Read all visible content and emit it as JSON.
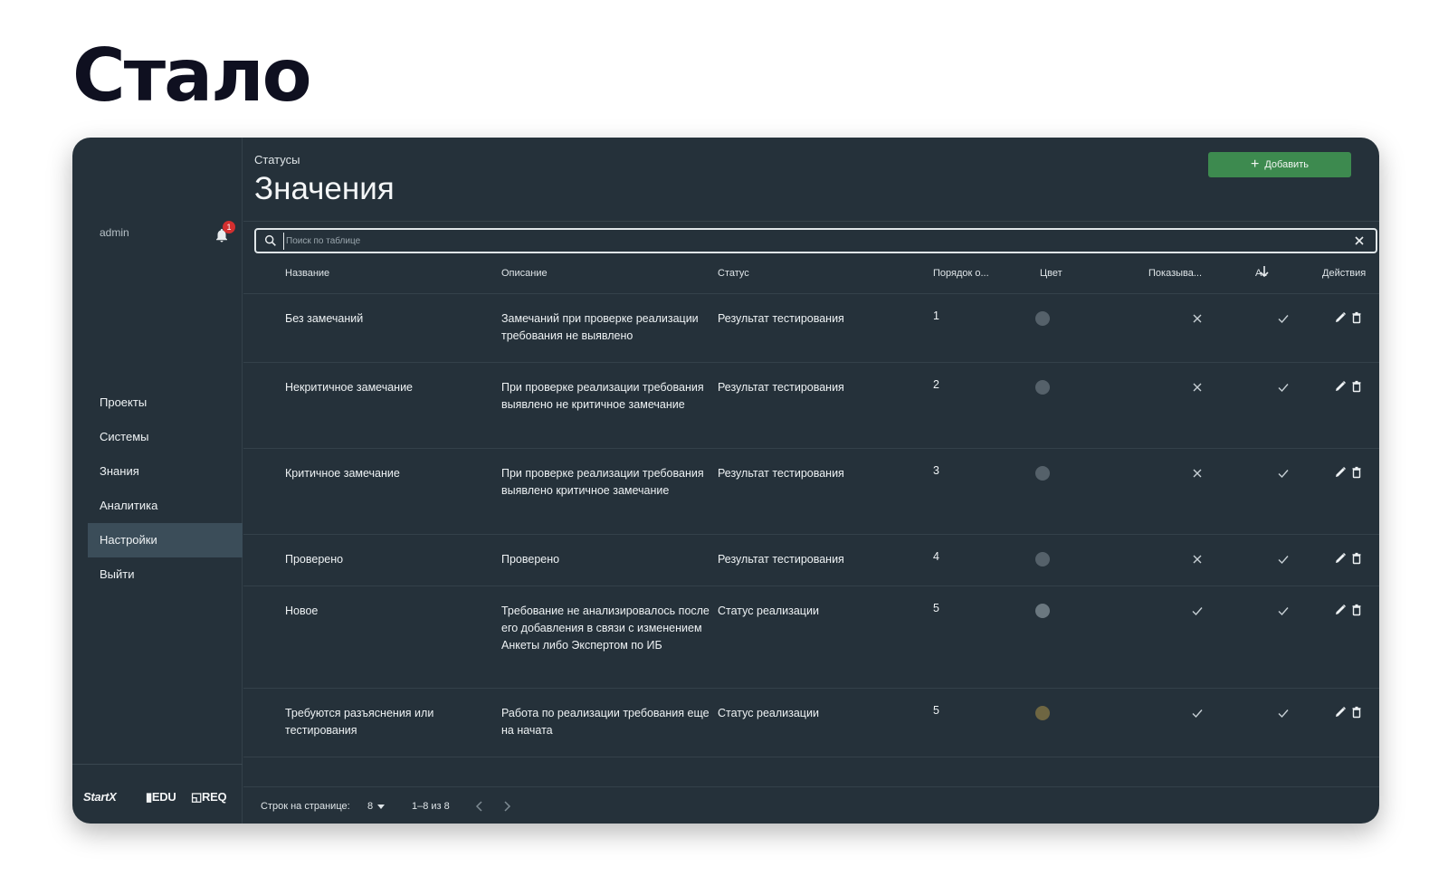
{
  "heading": "Стало",
  "sidebar": {
    "user": "admin",
    "notifications": "1",
    "items": [
      {
        "label": "Проекты"
      },
      {
        "label": "Системы"
      },
      {
        "label": "Знания"
      },
      {
        "label": "Аналитика"
      },
      {
        "label": "Настройки",
        "active": true
      },
      {
        "label": "Выйти"
      }
    ],
    "logos": {
      "startx": "StartX",
      "edu": "EDU",
      "req": "REQ"
    }
  },
  "main": {
    "breadcrumb": "Статусы",
    "title": "Значения",
    "add_label": "Добавить",
    "search_placeholder": "Поиск по таблице"
  },
  "table": {
    "columns": {
      "name": "Название",
      "description": "Описание",
      "status": "Статус",
      "order": "Порядок о...",
      "color": "Цвет",
      "show": "Показыва...",
      "active": "А..",
      "actions": "Действия"
    },
    "rows": [
      {
        "name": "Без замечаний",
        "description": "Замечаний при проверке реализации требования не выявлено",
        "status": "Результат тестирования",
        "order": "1",
        "color": "#55616a",
        "show": false,
        "active": true
      },
      {
        "name": "Некритичное замечание",
        "description": "При проверке реализации требования выявлено не критичное замечание",
        "status": "Результат тестирования",
        "order": "2",
        "color": "#55616a",
        "show": false,
        "active": true
      },
      {
        "name": "Критичное замечание",
        "description": "При проверке реализации требования выявлено критичное замечание",
        "status": "Результат тестирования",
        "order": "3",
        "color": "#55616a",
        "show": false,
        "active": true
      },
      {
        "name": "Проверено",
        "description": "Проверено",
        "status": "Результат тестирования",
        "order": "4",
        "color": "#55616a",
        "show": false,
        "active": true
      },
      {
        "name": "Новое",
        "description": "Требование не анализировалось после его добавления в связи с изменением Анкеты либо Экспертом по ИБ",
        "status": "Статус реализации",
        "order": "5",
        "color": "#6b7880",
        "show": true,
        "active": true
      },
      {
        "name": "Требуются разъяснения или тестирования",
        "description": "Работа по реализации требования еще на начата",
        "status": "Статус реализации",
        "order": "5",
        "color": "#6e6642",
        "show": true,
        "active": true
      }
    ]
  },
  "pagination": {
    "rows_label": "Строк на странице:",
    "rows_value": "8",
    "range": "1–8 из 8"
  },
  "colors": {
    "accent": "#3d8a4f",
    "background": "#25313a",
    "badge": "#d32f2f"
  }
}
